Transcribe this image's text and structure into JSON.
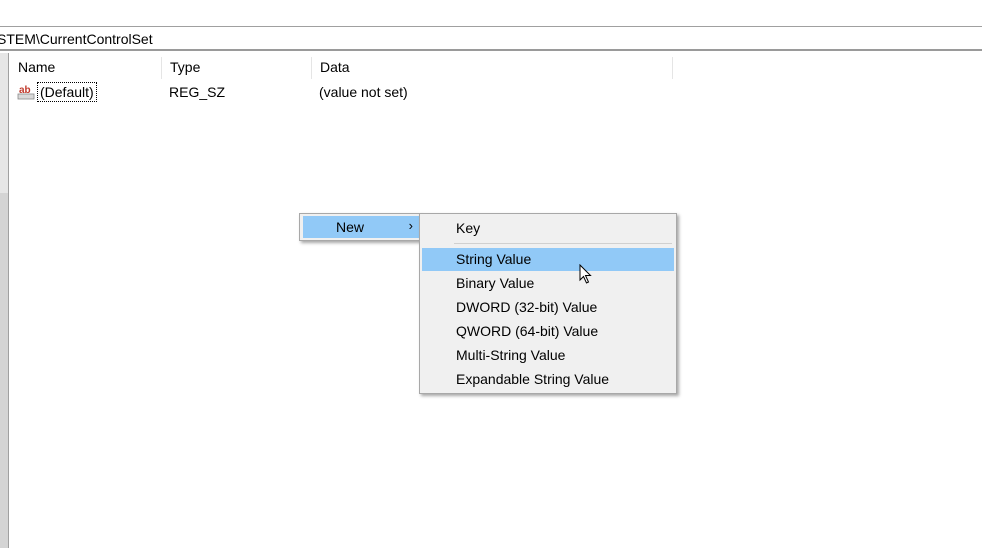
{
  "address_bar": {
    "path": "STEM\\CurrentControlSet"
  },
  "list": {
    "columns": [
      "Name",
      "Type",
      "Data"
    ],
    "rows": [
      {
        "icon": "string-value-icon",
        "name": "(Default)",
        "type": "REG_SZ",
        "data": "(value not set)"
      }
    ]
  },
  "context_menu": {
    "new_label": "New",
    "new_arrow": "›"
  },
  "submenu": {
    "items": [
      "Key",
      "String Value",
      "Binary Value",
      "DWORD (32-bit) Value",
      "QWORD (64-bit) Value",
      "Multi-String Value",
      "Expandable String Value"
    ],
    "highlighted": "String Value"
  },
  "colors": {
    "highlight": "#91c9f7",
    "menu_bg": "#f0f0f0"
  }
}
